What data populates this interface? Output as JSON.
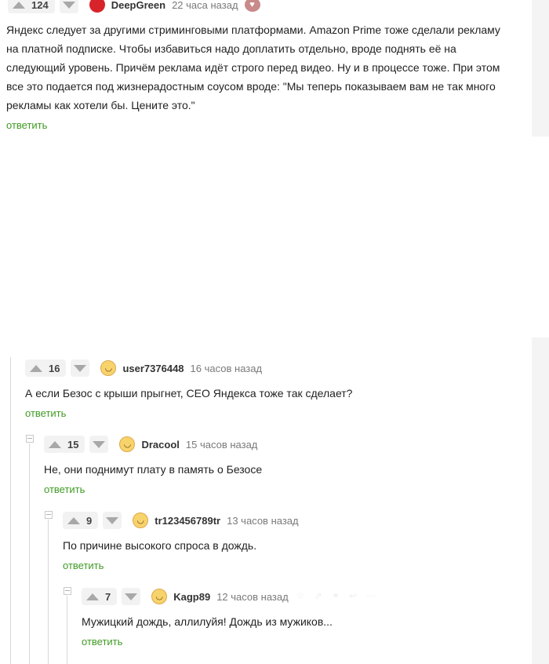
{
  "colors": {
    "reply_link": "#3f9b23",
    "vote_arrow": "#a8a8a8",
    "author_avatar": "#d8232a"
  },
  "comments": [
    {
      "rating": "124",
      "author": "DeepGreen",
      "time": "22 часа назад",
      "text": "Яндекс следует за другими стриминговыми платформами. Amazon Prime тоже сделали рекламу на платной подписке. Чтобы избавиться надо доплатить отдельно, вроде поднять её на следующий уровень. Причём реклама идёт строго перед видео. Ну и в процессе тоже. При этом все это подается под жизнерадостным соусом вроде: \"Мы теперь показываем вам не так много рекламы как хотели бы. Цените это.\"",
      "reply": "ответить"
    },
    {
      "rating": "16",
      "author": "user7376448",
      "time": "16 часов назад",
      "text": "А если Безос с крыши прыгнет, CEO Яндекса тоже так сделает?",
      "reply": "ответить"
    },
    {
      "rating": "15",
      "author": "Dracool",
      "time": "15 часов назад",
      "text": "Не, они поднимут плату в память о Безосе",
      "reply": "ответить"
    },
    {
      "rating": "9",
      "author": "tr123456789tr",
      "time": "13 часов назад",
      "text": "По причине высокого спроса в дождь.",
      "reply": "ответить"
    },
    {
      "rating": "7",
      "author": "Kagp89",
      "time": "12 часов назад",
      "text": "Мужицкий дождь, аллилуйя! Дождь из мужиков...",
      "reply": "ответить"
    }
  ]
}
